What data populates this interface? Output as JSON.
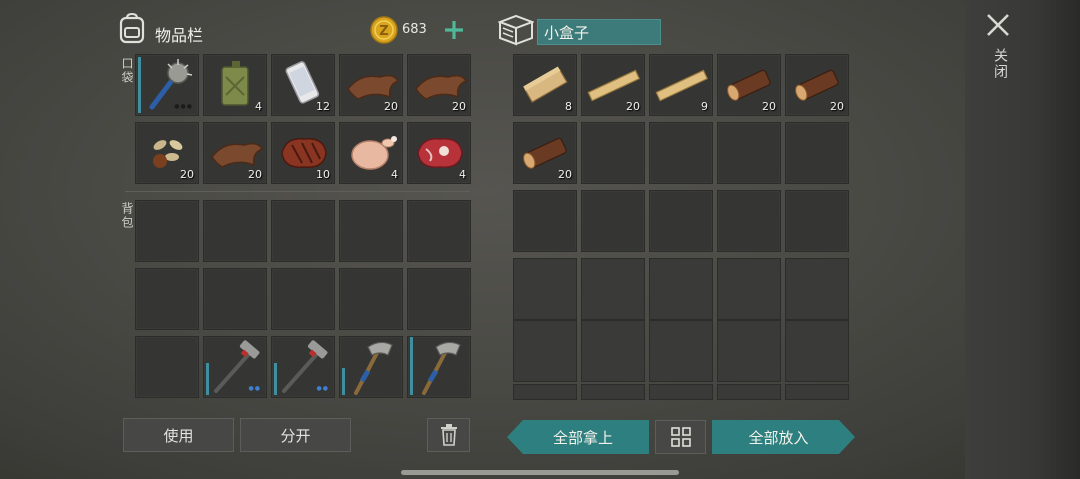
{
  "inventory": {
    "title": "物品栏",
    "coins": "683",
    "pocket_label": "口袋",
    "backpack_label": "背包",
    "pocket_slots": [
      {
        "item": "spiked-club",
        "count": "",
        "durability": 0.9
      },
      {
        "item": "jerrycan",
        "count": "4"
      },
      {
        "item": "smartphone",
        "count": "12"
      },
      {
        "item": "leather",
        "count": "20"
      },
      {
        "item": "leather",
        "count": "20"
      },
      {
        "item": "seeds",
        "count": "20"
      },
      {
        "item": "leather",
        "count": "20"
      },
      {
        "item": "grilled-steak",
        "count": "10"
      },
      {
        "item": "raw-chicken",
        "count": "4"
      },
      {
        "item": "raw-meat",
        "count": "4"
      }
    ],
    "backpack_slots": [
      {
        "item": "",
        "count": ""
      },
      {
        "item": "",
        "count": ""
      },
      {
        "item": "",
        "count": ""
      },
      {
        "item": "",
        "count": ""
      },
      {
        "item": "",
        "count": ""
      },
      {
        "item": "",
        "count": ""
      },
      {
        "item": "",
        "count": ""
      },
      {
        "item": "",
        "count": ""
      },
      {
        "item": "",
        "count": ""
      },
      {
        "item": "",
        "count": ""
      },
      {
        "item": "",
        "count": ""
      },
      {
        "item": "hammer",
        "count": "",
        "durability": 0.55
      },
      {
        "item": "hammer",
        "count": "",
        "durability": 0.55
      },
      {
        "item": "hatchet",
        "count": "",
        "durability": 0.45
      },
      {
        "item": "hatchet",
        "count": "",
        "durability": 0.95
      }
    ]
  },
  "container": {
    "name": "小盒子",
    "slots": [
      {
        "item": "wood-plank",
        "count": "8"
      },
      {
        "item": "board",
        "count": "20"
      },
      {
        "item": "board",
        "count": "9"
      },
      {
        "item": "log",
        "count": "20"
      },
      {
        "item": "log",
        "count": "20"
      },
      {
        "item": "log",
        "count": "20"
      }
    ]
  },
  "buttons": {
    "use": "使用",
    "split": "分开",
    "take_all": "全部拿上",
    "put_all": "全部放入",
    "close": "关闭"
  },
  "colors": {
    "accent_teal": "#2e7f7f",
    "coin_gold": "#d9a520",
    "plus_green": "#4fb89a"
  }
}
